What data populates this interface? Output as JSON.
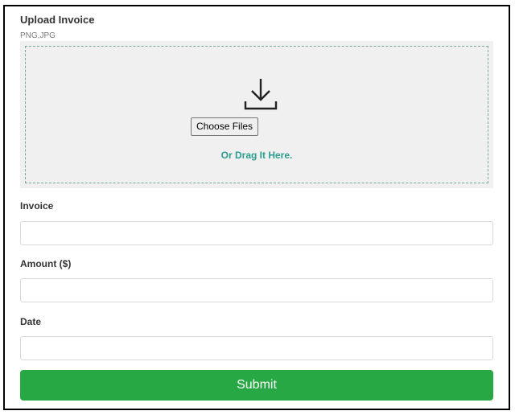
{
  "upload": {
    "title": "Upload Invoice",
    "formats": "PNG,JPG",
    "choose_button_label": "Choose Files",
    "drag_text": "Or Drag It Here.",
    "icon": "download-icon"
  },
  "fields": {
    "invoice": {
      "label": "Invoice",
      "value": "",
      "placeholder": ""
    },
    "amount": {
      "label": "Amount ($)",
      "value": "",
      "placeholder": ""
    },
    "date": {
      "label": "Date",
      "value": "",
      "placeholder": ""
    }
  },
  "submit_label": "Submit",
  "colors": {
    "accent_green": "#28a745",
    "drag_text": "#2a9d8f",
    "dropzone_bg": "#f0f0f0"
  }
}
